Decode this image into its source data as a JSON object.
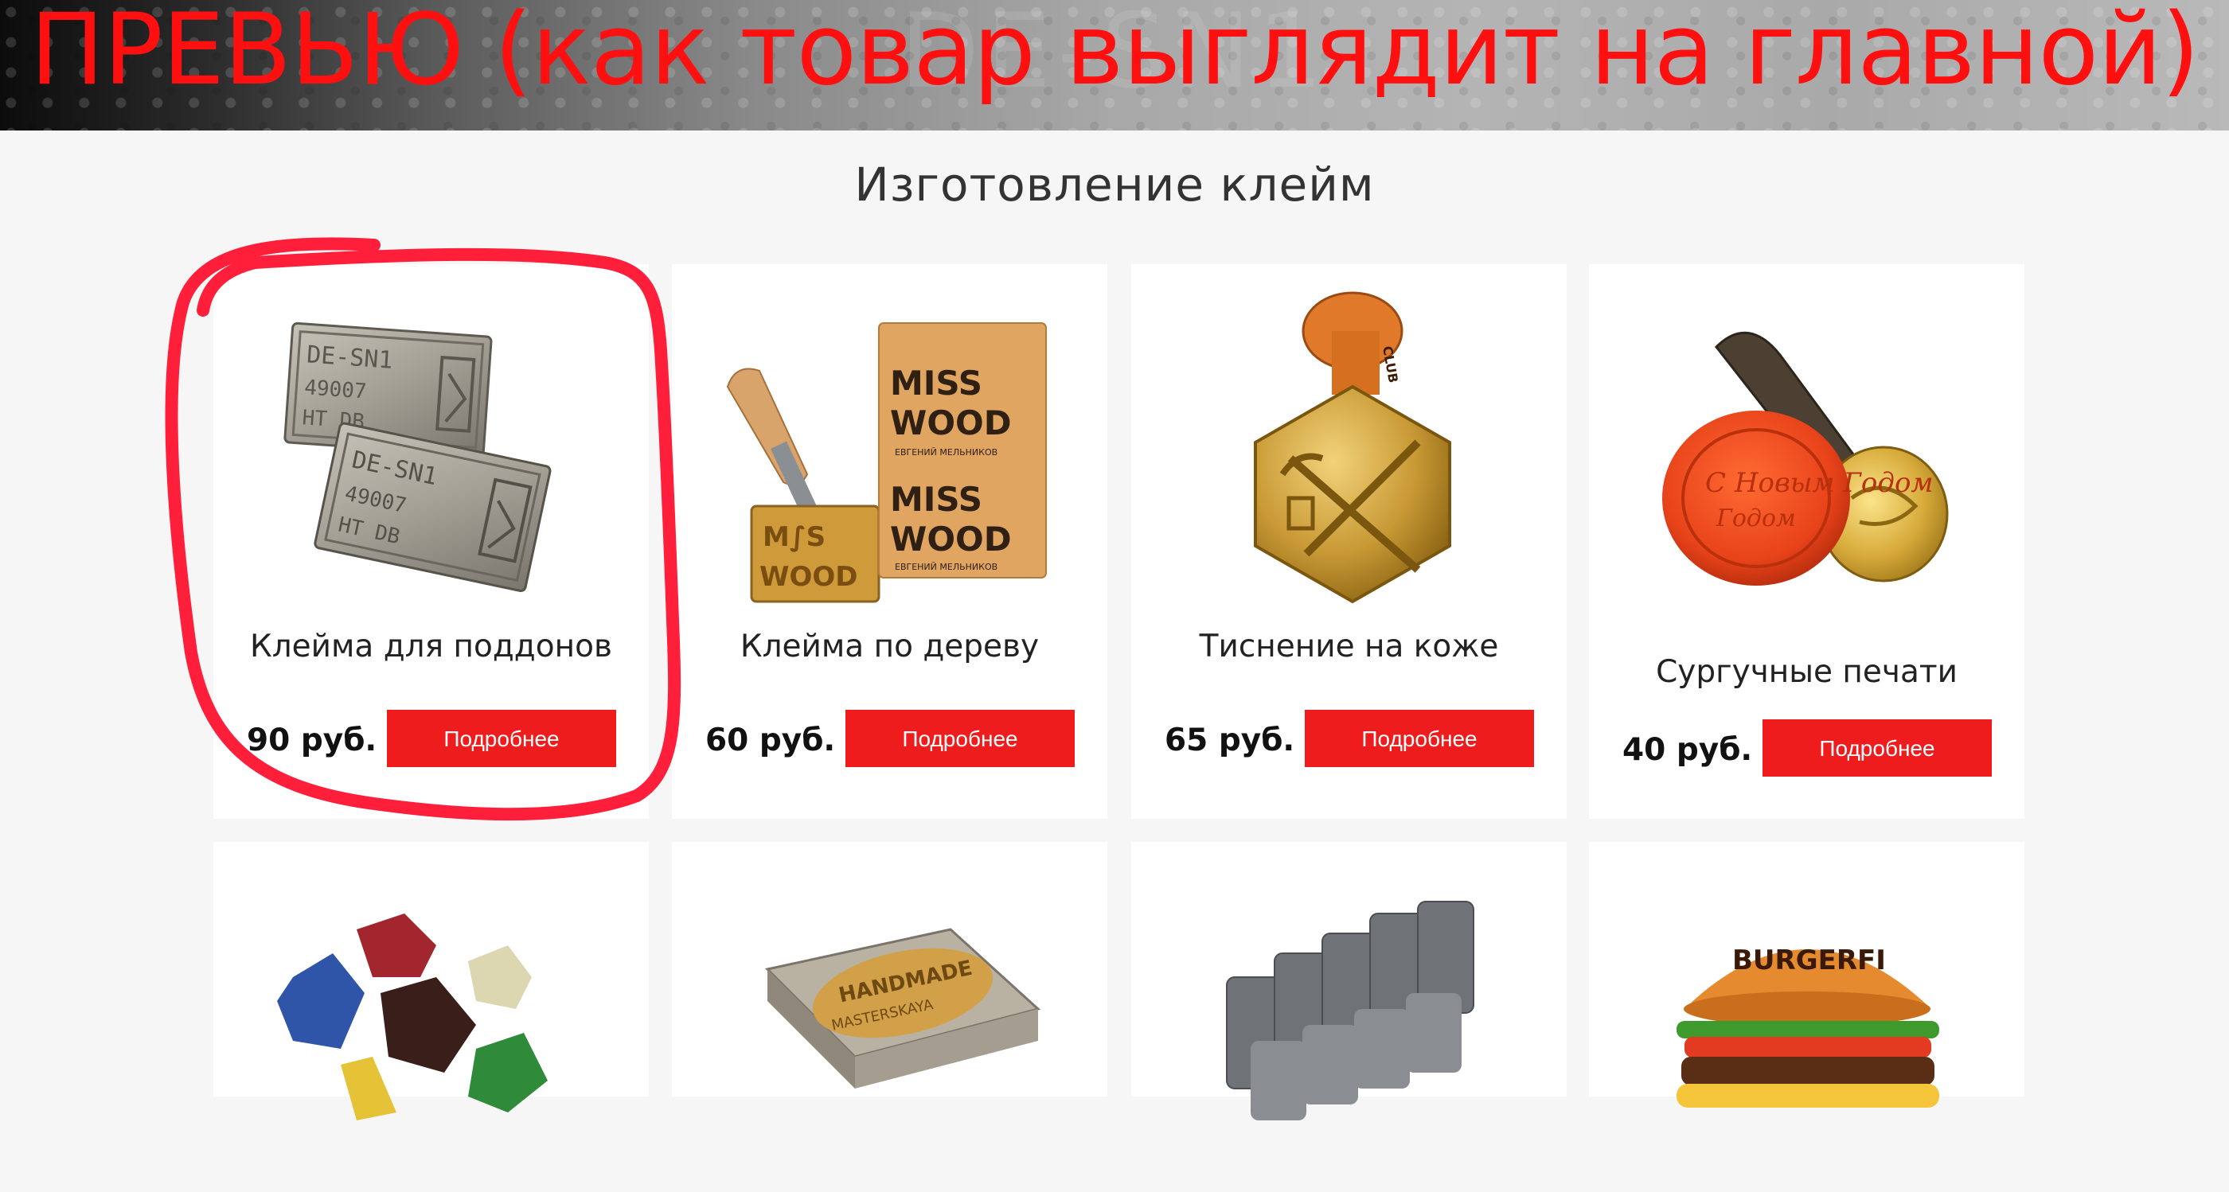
{
  "banner": {
    "annotation_text": "ПРЕВЬЮ (как товар выглядит на главной)",
    "background_text": "DE-SN1"
  },
  "section": {
    "title": "Изготовление клейм"
  },
  "products": [
    {
      "name": "Клейма для поддонов",
      "price": "90 руб.",
      "button_label": "Подробнее",
      "icon": "metal-pallet-stamps-image"
    },
    {
      "name": "Клейма по дереву",
      "price": "60 руб.",
      "button_label": "Подробнее",
      "icon": "wood-branding-iron-image"
    },
    {
      "name": "Тиснение на коже",
      "price": "65 руб.",
      "button_label": "Подробнее",
      "icon": "brass-leather-stamp-image"
    },
    {
      "name": "Сургучные печати",
      "price": "40 руб.",
      "button_label": "Подробнее",
      "icon": "wax-seal-image"
    },
    {
      "name": "",
      "price": "",
      "button_label": "",
      "icon": "sealing-wax-pieces-image"
    },
    {
      "name": "",
      "price": "",
      "button_label": "",
      "icon": "handmade-brass-plate-image"
    },
    {
      "name": "",
      "price": "",
      "button_label": "",
      "icon": "steel-letter-punches-image"
    },
    {
      "name": "",
      "price": "",
      "button_label": "",
      "icon": "branded-burger-image"
    }
  ],
  "image_texts": {
    "wood_block_1": "MISS",
    "wood_block_2": "WOOD",
    "wood_block_sub": "ЕВГЕНИЙ МЕЛЬНИКОВ",
    "leather_stamp": "CLUB",
    "brass_plate_1": "HANDMADE",
    "brass_plate_2": "MASTERSKAYA",
    "burger_bun": "BURGERFI",
    "pallet_stamp_1": "DE-SN1",
    "pallet_stamp_2": "HT DB",
    "wax_seal": "С Новым Годом"
  },
  "colors": {
    "accent": "#ee1c1c",
    "annotation": "#ff1010",
    "background": "#f6f6f6",
    "card": "#ffffff"
  }
}
